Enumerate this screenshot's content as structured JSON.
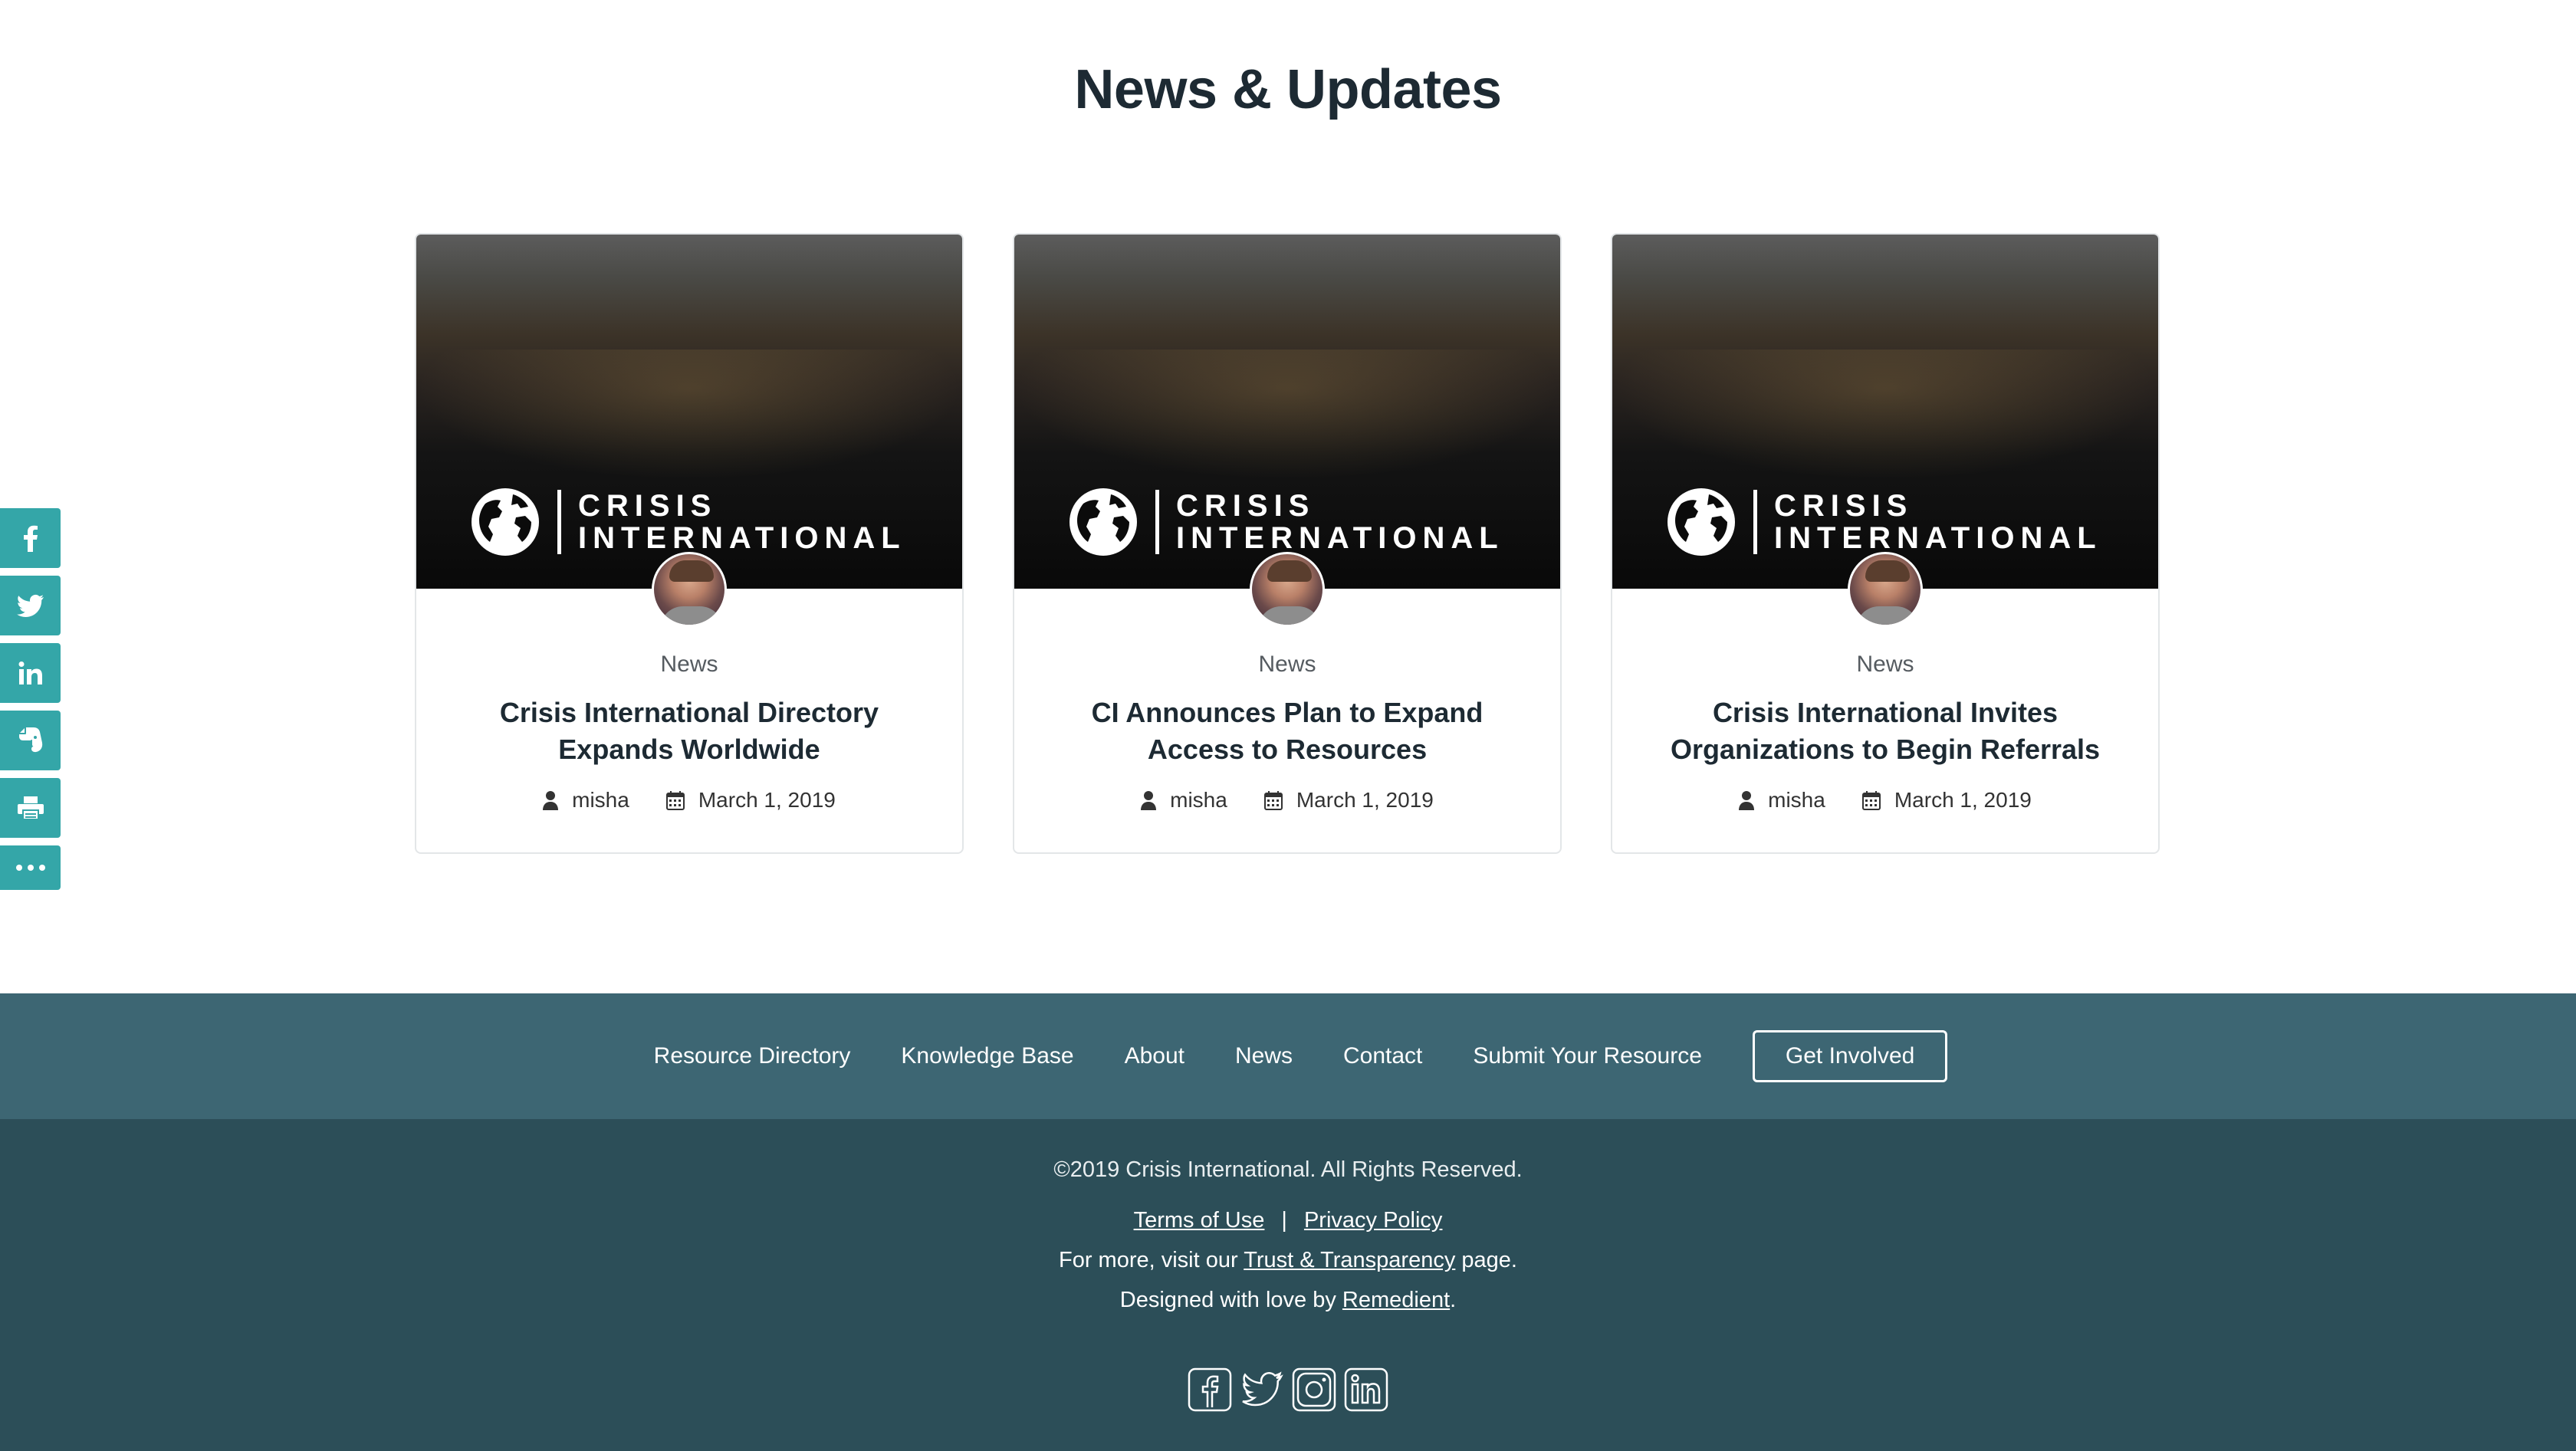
{
  "section": {
    "title": "News & Updates"
  },
  "share_rail": {
    "items": [
      {
        "icon": "facebook-icon"
      },
      {
        "icon": "twitter-icon"
      },
      {
        "icon": "linkedin-icon"
      },
      {
        "icon": "evernote-icon"
      },
      {
        "icon": "print-icon"
      },
      {
        "icon": "more-icon"
      }
    ]
  },
  "cards": [
    {
      "logo_line1": "CRISIS",
      "logo_line2": "INTERNATIONAL",
      "category": "News",
      "title": "Crisis International Directory Expands Worldwide",
      "author": "misha",
      "date": "March 1, 2019"
    },
    {
      "logo_line1": "CRISIS",
      "logo_line2": "INTERNATIONAL",
      "category": "News",
      "title": "CI Announces Plan to Expand Access to Resources",
      "author": "misha",
      "date": "March 1, 2019"
    },
    {
      "logo_line1": "CRISIS",
      "logo_line2": "INTERNATIONAL",
      "category": "News",
      "title": "Crisis International Invites Organizations to Begin Referrals",
      "author": "misha",
      "date": "March 1, 2019"
    }
  ],
  "footer": {
    "nav": [
      "Resource Directory",
      "Knowledge Base",
      "About",
      "News",
      "Contact",
      "Submit Your Resource"
    ],
    "cta": "Get Involved",
    "copyright": "©2019 Crisis International. All Rights Reserved.",
    "terms": "Terms of Use",
    "separator": "|",
    "privacy": "Privacy Policy",
    "visit_prefix": "For more, visit our ",
    "visit_link": "Trust & Transparency",
    "visit_suffix": " page.",
    "designed_prefix": "Designed with love by ",
    "designed_link": "Remedient",
    "designed_suffix": ".",
    "social": [
      "facebook-icon",
      "twitter-icon",
      "instagram-icon",
      "linkedin-icon"
    ]
  },
  "colors": {
    "share_rail": "#34a6a8",
    "footer_nav_bg": "#3d6673",
    "footer_bottom_bg": "#2c4e58",
    "title_text": "#1d2a33"
  }
}
